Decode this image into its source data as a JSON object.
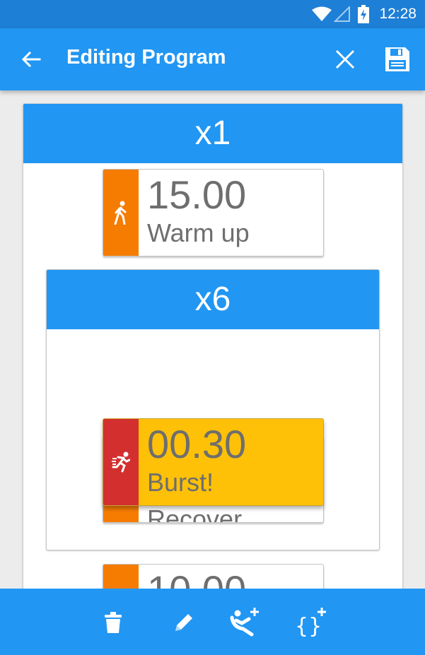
{
  "status_bar": {
    "time": "12:28",
    "icons": [
      "wifi-icon",
      "cell-signal-icon",
      "battery-charging-icon"
    ]
  },
  "app_bar": {
    "title": "Editing Program",
    "back_icon": "arrow-back-icon",
    "close_icon": "close-icon",
    "save_icon": "save-icon"
  },
  "program": {
    "outer_repeat": "x1",
    "steps": [
      {
        "duration": "15.00",
        "name": "Warm up",
        "color": "#f57c00",
        "icon": "walk-icon"
      }
    ],
    "inner_block": {
      "repeat": "x6",
      "dragging_step": {
        "duration": "00.30",
        "name": "Burst!",
        "strip_color": "#d32f2f",
        "body_color": "#ffc107",
        "icon": "sprint-icon"
      },
      "underlying_step": {
        "partial_name": "Recover",
        "color": "#f57c00"
      }
    },
    "next_step": {
      "partial_duration": "10.00",
      "color": "#f57c00"
    }
  },
  "bottom_bar": {
    "buttons": [
      "delete-icon",
      "edit-icon",
      "add-step-icon",
      "add-block-icon"
    ]
  },
  "colors": {
    "primary": "#2196f3",
    "status_bar": "#1e7fd6",
    "orange": "#f57c00",
    "red": "#d32f2f",
    "amber": "#ffc107"
  }
}
